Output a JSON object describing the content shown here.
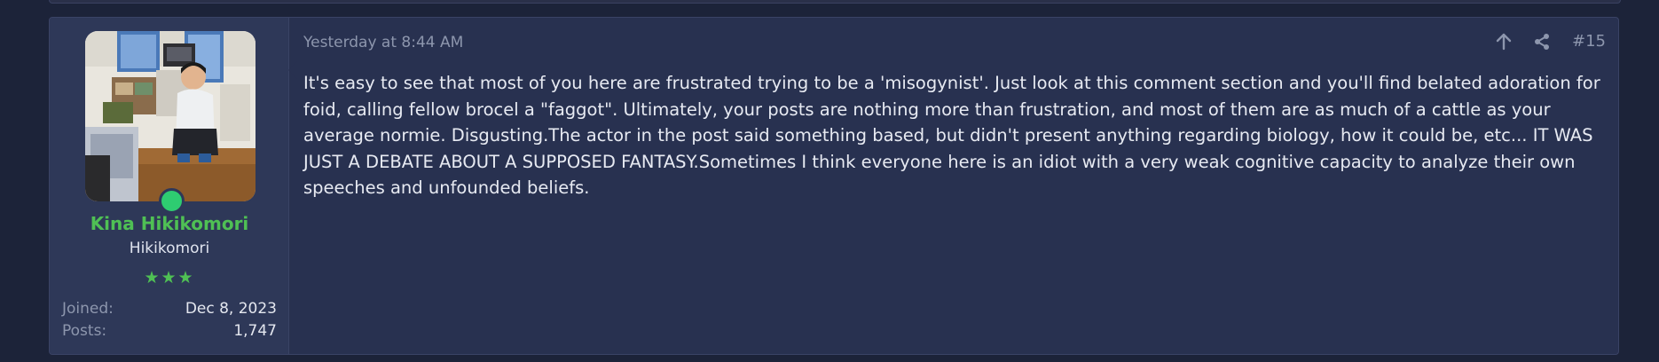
{
  "post": {
    "timestamp": "Yesterday at 8:44 AM",
    "number": "#15",
    "message": "It's easy to see that most of you here are frustrated trying to be a 'misogynist'. Just look at this comment section and you'll find belated adoration for foid, calling fellow brocel a \"faggot\". Ultimately, your posts are nothing more than frustration, and most of them are as much of a cattle as your average normie. Disgusting.The actor in the post said something based, but didn't present anything regarding biology, how it could be, etc... IT WAS JUST A DEBATE ABOUT A SUPPOSED FANTASY.Sometimes I think everyone here is an idiot with a very weak cognitive capacity to analyze their own speeches and unfounded beliefs."
  },
  "user": {
    "name": "Kina Hikikomori",
    "title": "Hikikomori",
    "stars": "★★★",
    "online": true,
    "joined_label": "Joined:",
    "joined_value": "Dec 8, 2023",
    "posts_label": "Posts:",
    "posts_value": "1,747"
  },
  "icons": {
    "up": "arrow-up-icon",
    "share": "share-icon",
    "online": "online-indicator-icon"
  },
  "colors": {
    "background": "#1c2339",
    "post_bg": "#283150",
    "user_cell_bg": "#2e3858",
    "username": "#4fc054",
    "online": "#2ecc71",
    "muted": "#8d96ad",
    "text": "#e7eaf2"
  }
}
